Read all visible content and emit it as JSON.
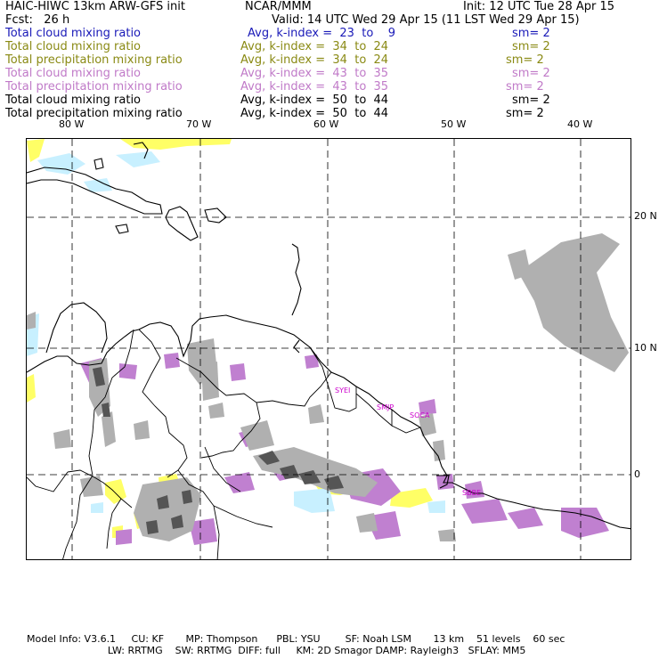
{
  "header": {
    "title": "HAIC-HIWC 13km ARW-GFS init",
    "org": "NCAR/MMM",
    "init": "Init: 12 UTC Tue 28 Apr 15",
    "fcst": "Fcst:   26 h",
    "valid": "Valid: 14 UTC Wed 29 Apr 15 (11 LST Wed 29 Apr 15)"
  },
  "legend": [
    {
      "field": "Total cloud mixing ratio",
      "avg": "Avg, k-index =  23  to    9",
      "sm": "sm= 2",
      "color": "#1a1ab8"
    },
    {
      "field": "Total cloud mixing ratio",
      "avg": "Avg, k-index =  34  to  24",
      "sm": "sm= 2",
      "color": "#8a8a14"
    },
    {
      "field": "Total precipitation mixing ratio",
      "avg": "Avg, k-index =  34  to  24",
      "sm": "sm= 2",
      "color": "#8a8a14"
    },
    {
      "field": "Total cloud mixing ratio",
      "avg": "Avg, k-index =  43  to  35",
      "sm": "sm= 2",
      "color": "#c07ac8"
    },
    {
      "field": "Total precipitation mixing ratio",
      "avg": "Avg, k-index =  43  to  35",
      "sm": "sm= 2",
      "color": "#c07ac8"
    },
    {
      "field": "Total cloud mixing ratio",
      "avg": "Avg, k-index =  50  to  44",
      "sm": "sm= 2",
      "color": "#000000"
    },
    {
      "field": "Total precipitation mixing ratio",
      "avg": "Avg, k-index =  50  to  44",
      "sm": "sm= 2",
      "color": "#000000"
    }
  ],
  "map": {
    "lon_labels": [
      "80 W",
      "70 W",
      "60 W",
      "50 W",
      "40 W"
    ],
    "lat_labels": [
      "20 N",
      "10 N",
      "0"
    ],
    "stations": [
      "SYEI",
      "SMJP",
      "SOCA",
      "SBBE"
    ],
    "colors": {
      "yellow": "#ffff66",
      "lightblue": "#c8f0ff",
      "violet": "#c080d0",
      "gray": "#b0b0b0",
      "darkgray": "#555555",
      "station": "#cc00cc"
    }
  },
  "footer": {
    "line1": "Model Info: V3.6.1     CU: KF       MP: Thompson      PBL: YSU        SF: Noah LSM       13 km    51 levels    60 sec",
    "line2": "                          LW: RRTMG    SW: RRTMG  DIFF: full     KM: 2D Smagor DAMP: Rayleigh3   SFLAY: MM5"
  }
}
